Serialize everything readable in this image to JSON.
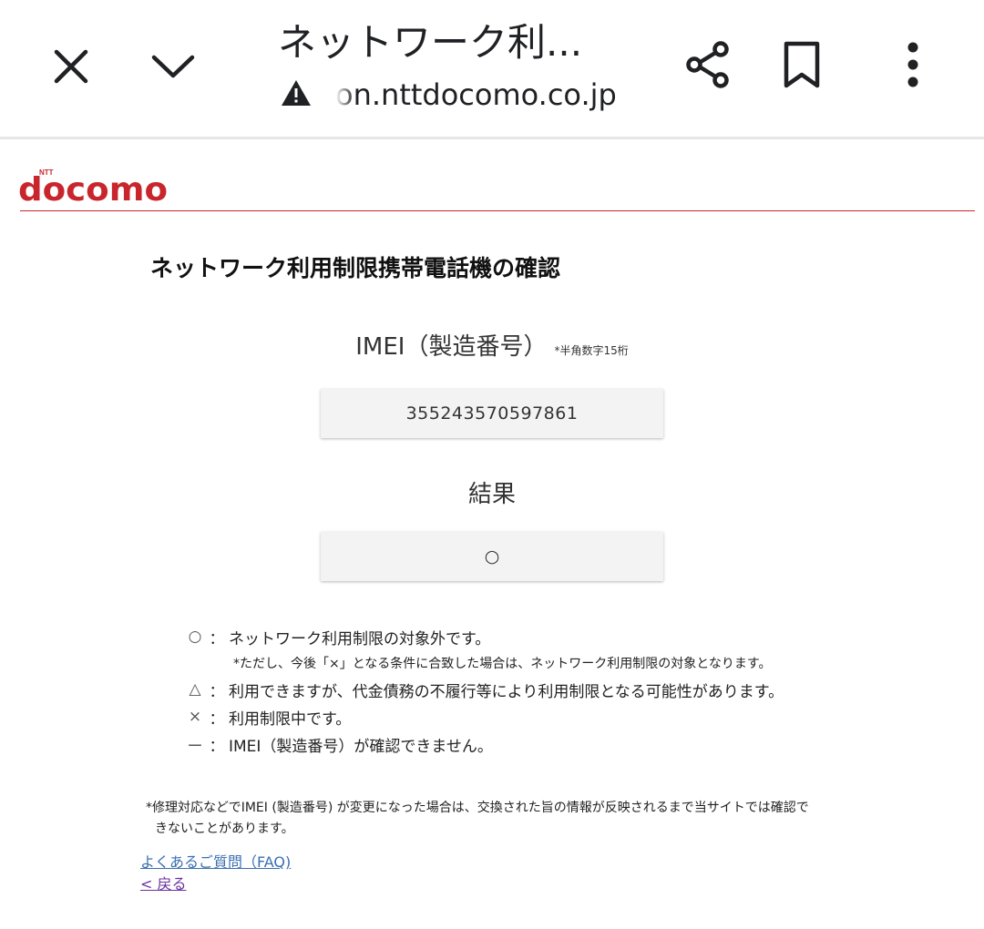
{
  "browser": {
    "title": "ネットワーク利...",
    "url": "on.nttdocomo.co.jp",
    "icons": [
      "close-icon",
      "chevron-down-icon",
      "warning-icon",
      "share-icon",
      "bookmark-icon",
      "more-vert-icon"
    ]
  },
  "header": {
    "brand_small": "NTT",
    "brand": "docomo",
    "brand_color": "#c8262c"
  },
  "main": {
    "title": "ネットワーク利用制限携帯電話機の確認",
    "imei_label": "IMEI（製造番号）",
    "imei_note": "*半角数字15桁",
    "imei_value": "355243570597861",
    "result_label": "結果",
    "result_value": "○"
  },
  "legend": {
    "items": [
      {
        "symbol": "○",
        "sep": "：",
        "text": "ネットワーク利用制限の対象外です。"
      },
      {
        "symbol": "△",
        "sep": "：",
        "text": "利用できますが、代金債務の不履行等により利用制限となる可能性があります。"
      },
      {
        "symbol": "×",
        "sep": "：",
        "text": "利用制限中です。"
      },
      {
        "symbol": "ー",
        "sep": "：",
        "text": "IMEI（製造番号）が確認できません。"
      }
    ],
    "note": "*ただし、今後「×」となる条件に合致した場合は、ネットワーク利用制限の対象となります。"
  },
  "footnote": {
    "line1": "*修理対応などでIMEI (製造番号) が変更になった場合は、交換された旨の情報が反映されるまで当サイトでは確認で",
    "line2": "きないことがあります。"
  },
  "links": {
    "faq": "よくあるご質問（FAQ)",
    "back": "< 戻る"
  }
}
